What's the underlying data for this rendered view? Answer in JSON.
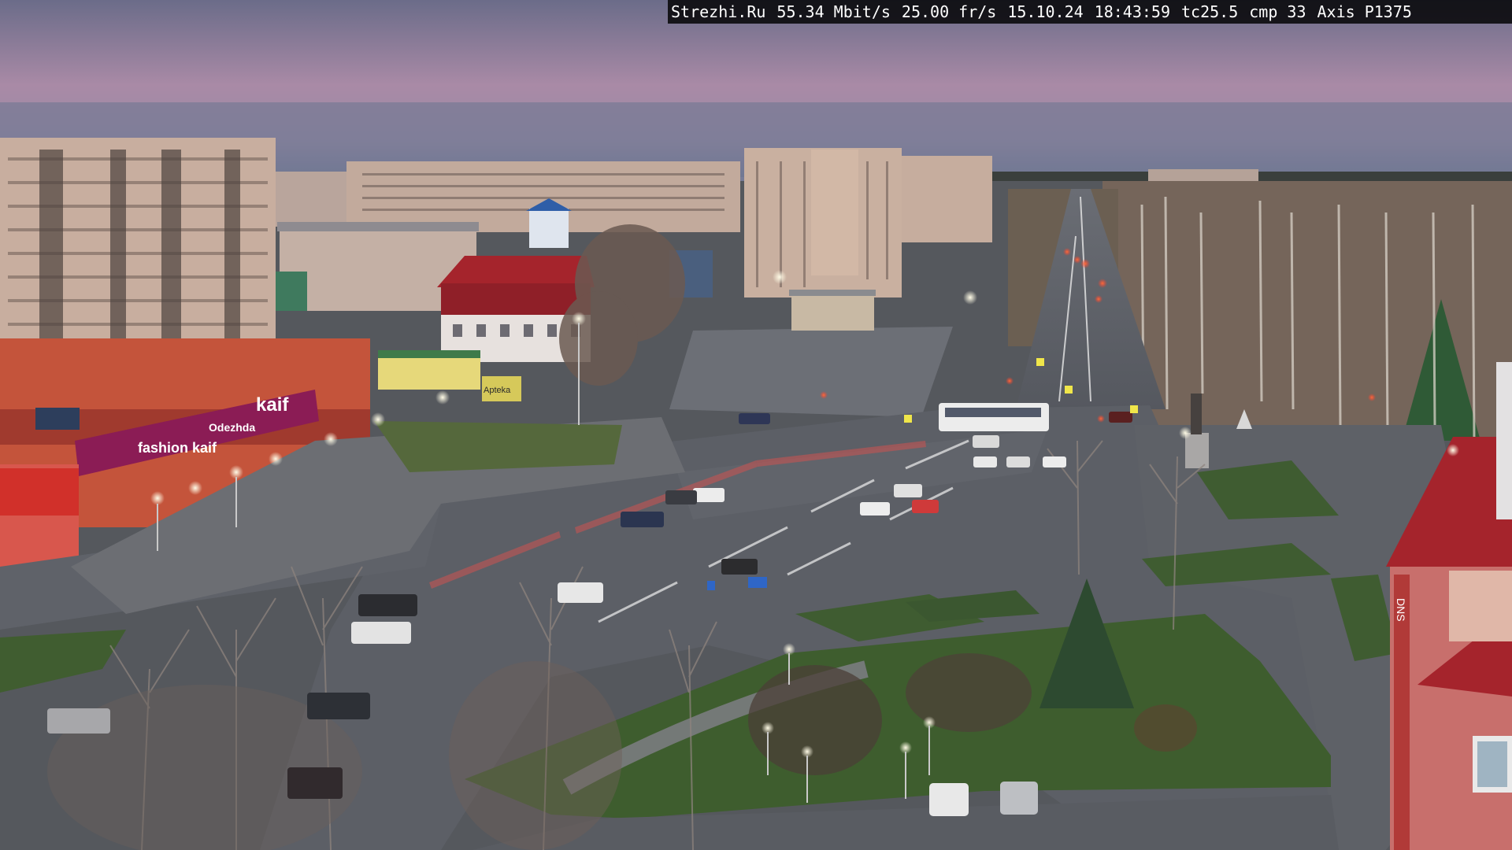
{
  "osd": {
    "site": "Strezhi.Ru",
    "bitrate": "55.34 Mbit/s",
    "fps": "25.00 fr/s",
    "date": "15.10.24",
    "time": "18:43:59",
    "tc": "tc25.5",
    "cmp": "cmp 33",
    "camera": "Axis P1375"
  },
  "signs": {
    "store_main": "kaif",
    "store_left": "fashion kaif",
    "store_small": "Odezhda",
    "pharmacy": "Apteka",
    "tower_sign": "DNS"
  },
  "colors": {
    "sky_top": "#6d6e8a",
    "sky_pink": "#b58da4",
    "asphalt": "#5a5e66",
    "grass": "#3d5a2c",
    "store_red": "#b3322a",
    "store_magenta": "#8b1c55",
    "roof_red": "#a5242c"
  }
}
